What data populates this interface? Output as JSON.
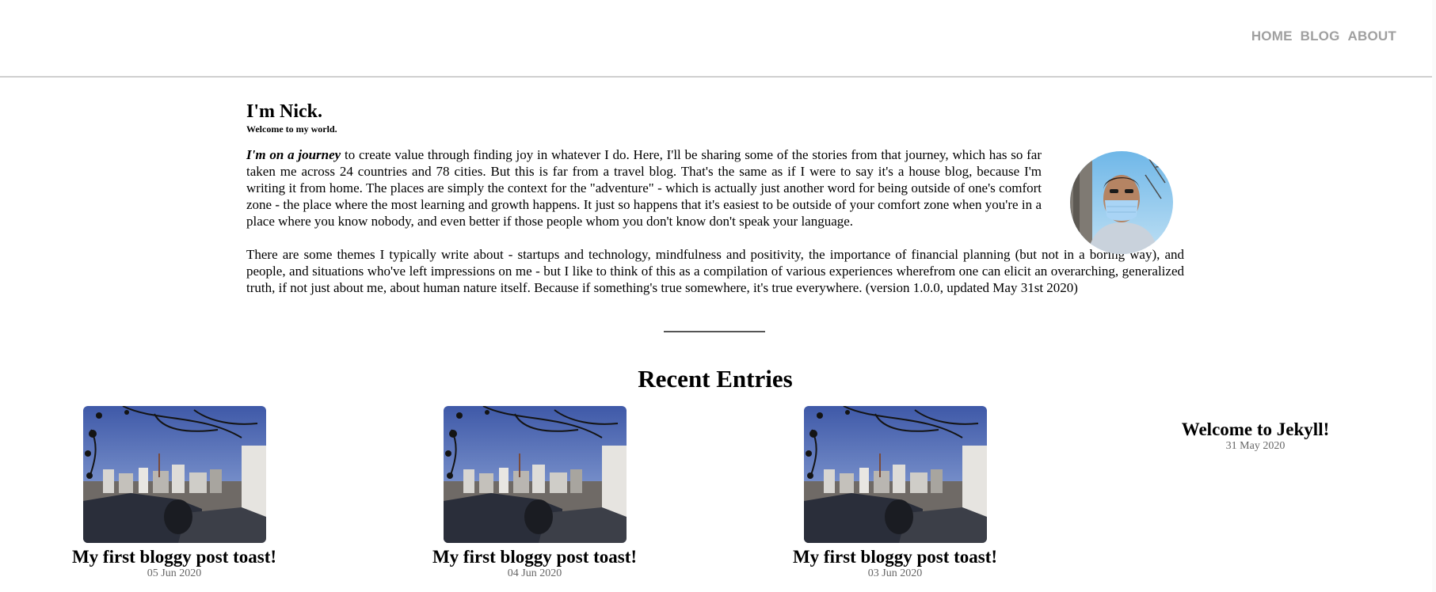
{
  "nav": {
    "items": [
      "HOME",
      "BLOG",
      "ABOUT"
    ]
  },
  "intro": {
    "heading": "I'm Nick.",
    "subtitle": "Welcome to my world.",
    "lead": "I'm on a journey",
    "paragraph1_rest": " to create value through finding joy in whatever I do. Here, I'll be sharing some of the stories from that journey, which has so far taken me across 24 countries and 78 cities. But this is far from a travel blog. That's the same as if I were to say it's a house blog, because I'm writing it from home. The places are simply the context for the \"adventure\" - which is actually just another word for being outside of one's comfort zone - the place where the most learning and growth happens. It just so happens that it's easiest to be outside of your comfort zone when you're in a place where you know nobody, and even better if those people whom you don't know don't speak your language.",
    "paragraph2": "There are some themes I typically write about - startups and technology, mindfulness and positivity, the importance of financial planning (but not in a boring way), and people, and situations who've left impressions on me - but I like to think of this as a compilation of various experiences wherefrom one can elicit an overarching, generalized truth, if not just about me, about human nature itself. Because if something's true somewhere, it's true everywhere. (version 1.0.0, updated May 31st 2020)"
  },
  "recent": {
    "title": "Recent Entries",
    "posts": [
      {
        "title": "My first bloggy post toast!",
        "date": "05 Jun 2020"
      },
      {
        "title": "My first bloggy post toast!",
        "date": "04 Jun 2020"
      },
      {
        "title": "My first bloggy post toast!",
        "date": "03 Jun 2020"
      },
      {
        "title": "Welcome to Jekyll!",
        "date": "31 May 2020"
      }
    ]
  },
  "colors": {
    "nav_text": "#a0a0a0",
    "header_border": "#cfcfcf",
    "date_text": "#666666"
  }
}
